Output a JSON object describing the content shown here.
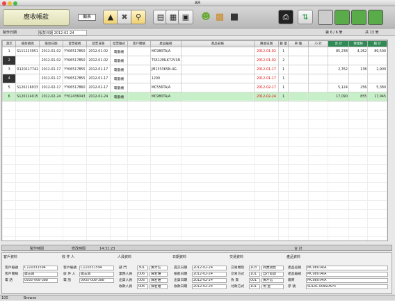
{
  "window": {
    "title": "AR"
  },
  "toolbar": {
    "title": "應收帳款",
    "mode_chars": [
      "顯",
      "表"
    ]
  },
  "status": {
    "left": "製作日期",
    "date": "帳款日期 2012-02-24",
    "record": "第 6 / 6 筆",
    "count": "共 13 筆"
  },
  "table": {
    "headers": [
      "演示",
      "帳款號碼",
      "帳款日期",
      "發票號碼",
      "發票日期",
      "發票聯式",
      "客戶簡稱",
      "產品編號",
      "產品名稱",
      "應收日期",
      "數 量",
      "單 價",
      "小 計",
      "合 計",
      "營業稅",
      "總 計"
    ],
    "rows": [
      {
        "id": "1",
        "no": "S111223951",
        "d": "2012-01-02",
        "inv": "YY06517850",
        "invd": "2012-01-02",
        "kind": "電腦機",
        "cust": "",
        "prod": "MC980TA/A",
        "name": "",
        "due": "2012-01-02",
        "qty": "1",
        "price": "",
        "sub": "",
        "sum": "85,238",
        "tax": "4,262",
        "total": "89,500"
      },
      {
        "id": "2",
        "no": "",
        "d": "2012-01-02",
        "inv": "YY06517850",
        "invd": "2012-01-02",
        "kind": "電腦機",
        "cust": "",
        "prod": "TS512MLK72V1N",
        "name": "",
        "due": "2012-01-02",
        "qty": "2",
        "price": "",
        "sub": "",
        "sum": "",
        "tax": "",
        "total": ""
      },
      {
        "id": "3",
        "no": "R120117742",
        "d": "2012-01-17",
        "inv": "YY06517855",
        "invd": "2012-01-17",
        "kind": "電腦機",
        "cust": "",
        "prod": "JM1333KSN-4G",
        "name": "",
        "due": "2012-01-17",
        "qty": "1",
        "price": "",
        "sub": "",
        "sum": "2,762",
        "tax": "138",
        "total": "2,900"
      },
      {
        "id": "4",
        "no": "",
        "d": "2012-01-17",
        "inv": "YY06517855",
        "invd": "2012-01-17",
        "kind": "電腦機",
        "cust": "",
        "prod": "1200",
        "name": "",
        "due": "2012-01-17",
        "qty": "1",
        "price": "",
        "sub": "",
        "sum": "",
        "tax": "",
        "total": ""
      },
      {
        "id": "5",
        "no": "S120216933",
        "d": "2012-02-17",
        "inv": "YY06517860",
        "invd": "2012-02-17",
        "kind": "電腦機",
        "cust": "",
        "prod": "MC556TA/A",
        "name": "",
        "due": "2012-02-17",
        "qty": "1",
        "price": "",
        "sub": "",
        "sum": "5,124",
        "tax": "256",
        "total": "5,380"
      },
      {
        "id": "6",
        "no": "S120224015",
        "d": "2012-02-24",
        "inv": "YY02436043",
        "invd": "2012-02-24",
        "kind": "電腦機",
        "cust": "",
        "prod": "MC980TA/A",
        "name": "",
        "due": "2012-02-24",
        "qty": "1",
        "price": "",
        "sub": "",
        "sum": "17,090",
        "tax": "855",
        "total": "17,945"
      }
    ]
  },
  "footer": {
    "a": "製作時間",
    "b": "修改時間",
    "c": "14:31:23",
    "total": "合 計"
  },
  "panel": {
    "g1": {
      "title": "客戶資料",
      "l1": "客戶編號",
      "v1": "C110331594",
      "l2": "客戶簡稱",
      "v2": "廣志興",
      "l3": "電 話",
      "v3": "0935-008-388"
    },
    "g2": {
      "title": "收 件 人",
      "l1": "客戶編號",
      "v1": "C110331594",
      "l2": "收 件 人",
      "v2": "廣志興",
      "l3": "電 話",
      "v3": "0935-008-388"
    },
    "g3": {
      "title": "人員資料",
      "l1": "部 門",
      "v1": "301",
      "n1": "黃才信",
      "l2": "業務人員",
      "v2": "006",
      "n2": "陳若維",
      "l3": "出貨人員",
      "v3": "006",
      "n3": "陳若維",
      "l4": "收款人員",
      "v4": "006",
      "n4": "陳若維"
    },
    "g4": {
      "title": "日期資料",
      "l1": "提交日期",
      "v1": "2012-02-24",
      "l2": "帳款日期",
      "v2": "2012-02-24",
      "l3": "出貨日期",
      "v3": "2012-02-24",
      "l4": "收款日期",
      "v4": "2012-02-24"
    },
    "g5": {
      "title": "交易資料",
      "l1": "交易類別",
      "v1": "103",
      "n1": "商業銷售",
      "l2": "交易方式",
      "v2": "101",
      "n2": "自行取貨",
      "l3": "負 責",
      "v3": "001",
      "n3": "黃才信",
      "l4": "付款方式",
      "v4": "101",
      "n4": "現 金"
    },
    "g6": {
      "title": "產品資料",
      "l1": "產品名稱",
      "v1": "MC980TA/A",
      "l2": "產品編號",
      "v2": "MC980TA/A",
      "l3": "廠商",
      "v3": "MC980TA/A",
      "l4": "序 號",
      "v4": "SDLXCTANSDKP3"
    }
  },
  "bottom": {
    "zoom": "100",
    "mode": "Browse"
  }
}
